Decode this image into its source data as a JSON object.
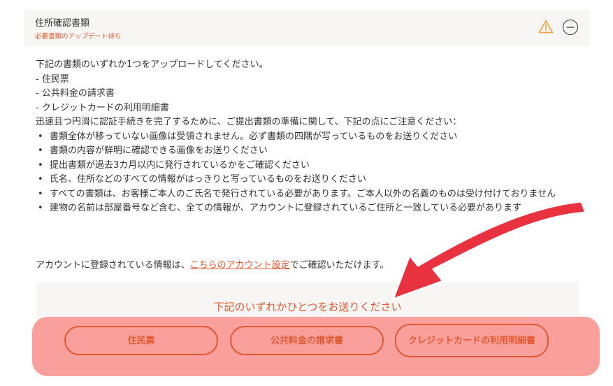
{
  "section": {
    "title": "住所確認書類",
    "status": "必要書類のアップデート待ち",
    "warning_icon": "warning-triangle-icon",
    "collapse_icon": "minus-circle-icon"
  },
  "instructions": {
    "intro": "下記の書類のいずれか1つをアップロードしてください。",
    "doc_types": [
      "- 住民票",
      "- 公共料金の請求書",
      "- クレジットカードの利用明細書"
    ],
    "notes_intro": "迅速且つ円滑に認証手続きを完了するために、ご提出書類の準備に関して、下記の点にご注意ください：",
    "notes": [
      "書類全体が移っていない画像は受領されません。必ず書類の四隅が写っているものをお送りください",
      "書類の内容が鮮明に確認できる画像をお送りください",
      "提出書類が過去3カ月以内に発行されているかをご確認ください",
      "氏名、住所などのすべての情報がはっきりと写っているものをお送りください",
      "すべての書類は、お客様ご本人のご氏名で発行されている必要があります。ご本人以外の名義のものは受け付けておりません",
      "建物の名前は部屋番号など含む、全ての情報が、アカウントに登録されているご住所と一致している必要があります"
    ]
  },
  "account": {
    "prefix": "アカウントに登録されている情報は、",
    "link": "こちらのアカウント設定",
    "suffix": "でご確認いただけます。"
  },
  "send": {
    "title": "下記のいずれかひとつをお送りください",
    "buttons": [
      "住民票",
      "公共料金の請求書",
      "クレジットカードの利用明細書"
    ]
  },
  "colors": {
    "accent": "#e2582f",
    "highlight": "#f9a09c",
    "arrow": "#e8323f",
    "panel": "#f7f6f5"
  }
}
